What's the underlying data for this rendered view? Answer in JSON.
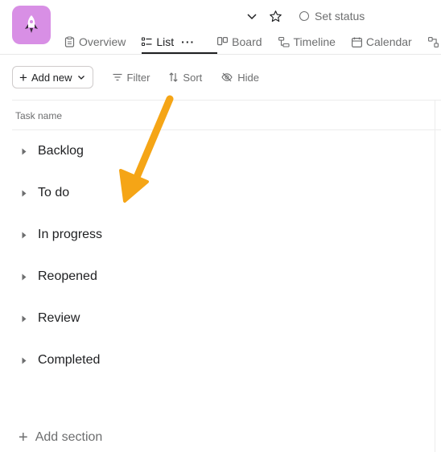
{
  "header": {
    "set_status_label": "Set status",
    "app_icon": "rocket-icon",
    "app_icon_color": "#d88fe5"
  },
  "tabs": [
    {
      "label": "Overview",
      "icon": "clipboard-icon"
    },
    {
      "label": "List",
      "icon": "list-icon",
      "active": true,
      "more": "···"
    },
    {
      "label": "Board",
      "icon": "board-icon"
    },
    {
      "label": "Timeline",
      "icon": "timeline-icon"
    },
    {
      "label": "Calendar",
      "icon": "calendar-icon"
    }
  ],
  "toolbar": {
    "add_new_label": "Add new",
    "filter_label": "Filter",
    "sort_label": "Sort",
    "hide_label": "Hide"
  },
  "table": {
    "column_header": "Task name"
  },
  "sections": [
    {
      "label": "Backlog"
    },
    {
      "label": "To do"
    },
    {
      "label": "In progress"
    },
    {
      "label": "Reopened"
    },
    {
      "label": "Review"
    },
    {
      "label": "Completed"
    }
  ],
  "add_section_label": "Add section",
  "annotation": {
    "arrow_color": "#f5a516"
  }
}
